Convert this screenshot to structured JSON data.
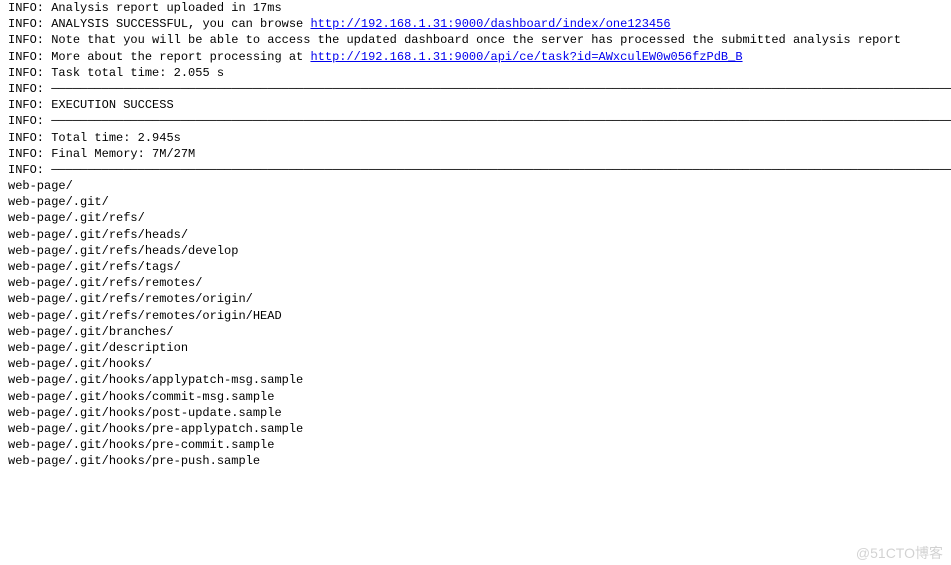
{
  "prefix": "INFO: ",
  "rule": "────────────────────────────────────────────────────────────────────────────────────────────────────────────────────────────────────────────────────",
  "lines": {
    "l0": "Analysis report uploaded in 17ms",
    "l1a": "ANALYSIS SUCCESSFUL, you can browse ",
    "l1link": "http://192.168.1.31:9000/dashboard/index/one123456",
    "l2": "Note that you will be able to access the updated dashboard once the server has processed the submitted analysis report",
    "l3a": "More about the report processing at ",
    "l3link": "http://192.168.1.31:9000/api/ce/task?id=AWxculEW0w056fzPdB_B",
    "l4": "Task total time: 2.055 s",
    "l5": "EXECUTION SUCCESS",
    "l6": "Total time: 2.945s",
    "l7": "Final Memory: 7M/27M"
  },
  "paths": [
    "web-page/",
    "web-page/.git/",
    "web-page/.git/refs/",
    "web-page/.git/refs/heads/",
    "web-page/.git/refs/heads/develop",
    "web-page/.git/refs/tags/",
    "web-page/.git/refs/remotes/",
    "web-page/.git/refs/remotes/origin/",
    "web-page/.git/refs/remotes/origin/HEAD",
    "web-page/.git/branches/",
    "web-page/.git/description",
    "web-page/.git/hooks/",
    "web-page/.git/hooks/applypatch-msg.sample",
    "web-page/.git/hooks/commit-msg.sample",
    "web-page/.git/hooks/post-update.sample",
    "web-page/.git/hooks/pre-applypatch.sample",
    "web-page/.git/hooks/pre-commit.sample",
    "web-page/.git/hooks/pre-push.sample"
  ],
  "watermark": "@51CTO博客"
}
